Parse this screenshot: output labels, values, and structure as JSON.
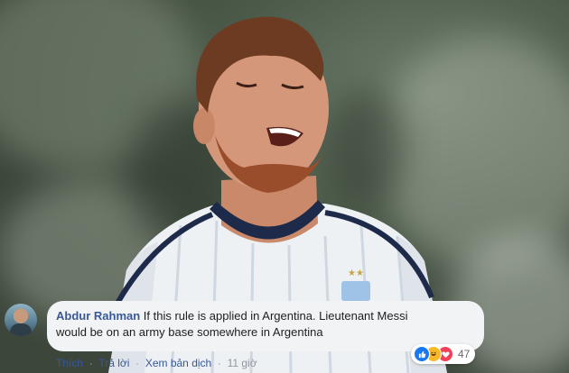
{
  "comment": {
    "author": "Abdur Rahman",
    "text": " If this rule is applied in Argentina. Lieutenant Messi would be on an army base somewhere in Argentina",
    "reaction_icons": [
      "like-icon",
      "haha-icon",
      "love-icon"
    ],
    "reaction_count": "47",
    "actions": {
      "like": "Thích",
      "reply": "Trả lời",
      "translate": "Xem bản dịch",
      "time": "11 giờ"
    }
  },
  "colors": {
    "author": "#385898",
    "bubble": "#f2f3f5",
    "like": "#1877f2",
    "haha": "#f7b928",
    "love": "#f33e58"
  }
}
